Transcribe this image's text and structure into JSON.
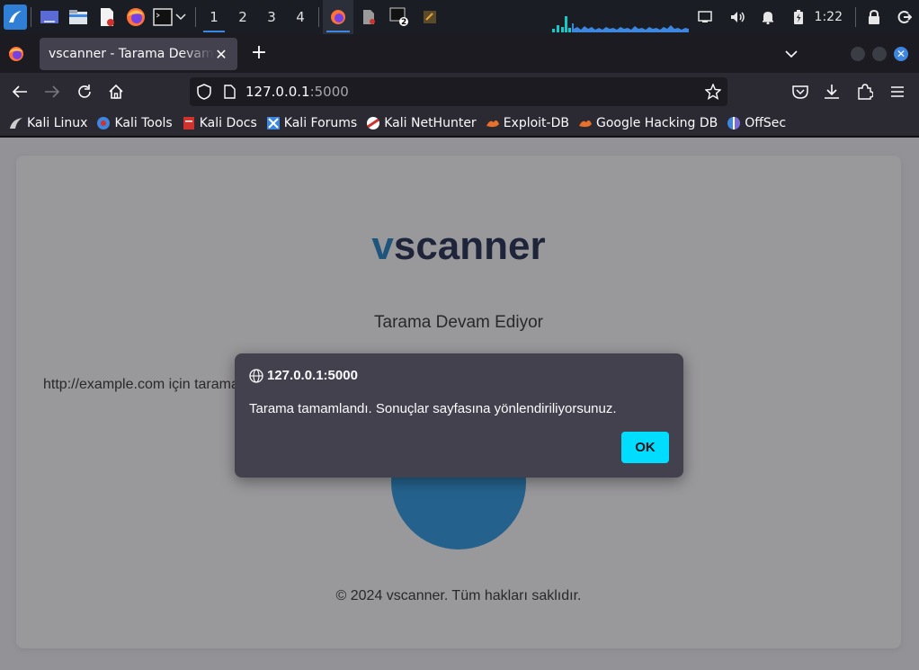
{
  "taskbar": {
    "workspaces": [
      "1",
      "2",
      "3",
      "4"
    ],
    "terminal_badge": "2",
    "clock": "1:22"
  },
  "browser": {
    "tab_title": "vscanner - Tarama Devam Ediyor",
    "url_host": "127.0.0.1",
    "url_port": ":5000"
  },
  "bookmarks": [
    {
      "label": "Kali Linux",
      "icon": "kali-dragon-icon",
      "color": "#cccccc"
    },
    {
      "label": "Kali Tools",
      "icon": "kali-tools-icon",
      "color": "#3d87e0"
    },
    {
      "label": "Kali Docs",
      "icon": "kali-docs-icon",
      "color": "#d0332d"
    },
    {
      "label": "Kali Forums",
      "icon": "kali-forums-icon",
      "color": "#3d87e0"
    },
    {
      "label": "Kali NetHunter",
      "icon": "nethunter-icon",
      "color": "#d0332d"
    },
    {
      "label": "Exploit-DB",
      "icon": "exploit-db-icon",
      "color": "#e8702a"
    },
    {
      "label": "Google Hacking DB",
      "icon": "ghdb-icon",
      "color": "#e8702a"
    },
    {
      "label": "OffSec",
      "icon": "offsec-icon",
      "color": "#7b6bd9"
    }
  ],
  "page": {
    "logo_v": "v",
    "logo_rest": "scanner",
    "status_title": "Tarama Devam Ediyor",
    "scan_text": "http://example.com için tarama devam ediyor...",
    "footer": "© 2024 vscanner. Tüm hakları saklıdır."
  },
  "dialog": {
    "origin": "127.0.0.1:5000",
    "message": "Tarama tamamlandı. Sonuçlar sayfasına yönlendiriliyorsunuz.",
    "ok_label": "OK"
  },
  "colors": {
    "accent": "#00ddff",
    "brand_blue": "#1f86c7",
    "brand_navy": "#1f2d4d"
  }
}
